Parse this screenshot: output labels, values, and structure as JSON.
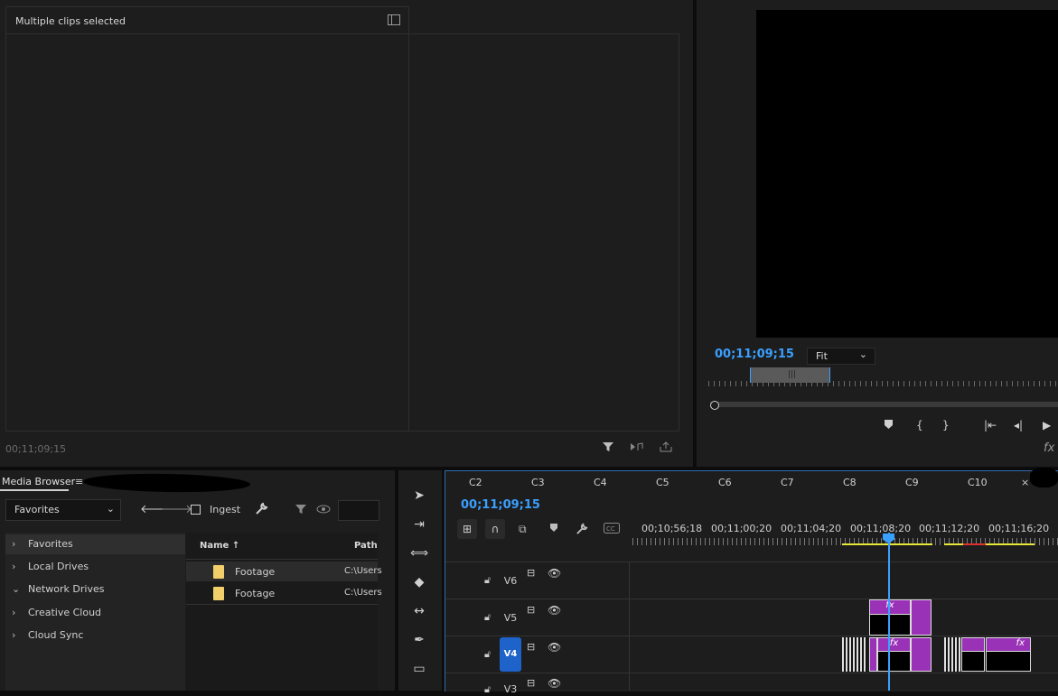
{
  "effect_controls": {
    "title": "Multiple clips selected",
    "timecode": "00;11;09;15"
  },
  "program_monitor": {
    "timecode": "00;11;09;15",
    "fit_selected": "Fit",
    "fx_label": "fx"
  },
  "media_browser": {
    "title": "Media Browser",
    "menu_glyph": "≡",
    "location_selected": "Favorites",
    "ingest_label": "Ingest",
    "tree": [
      {
        "label": "Favorites",
        "expanded": false
      },
      {
        "label": "Local Drives",
        "expanded": false
      },
      {
        "label": "Network Drives",
        "expanded": true
      },
      {
        "label": "Creative Cloud",
        "expanded": false
      },
      {
        "label": "Cloud Sync",
        "expanded": false
      }
    ],
    "columns": {
      "name": "Name",
      "path": "Path"
    },
    "rows": [
      {
        "name": "Footage",
        "path": "C:\\Users"
      },
      {
        "name": "Footage",
        "path": "C:\\Users"
      }
    ]
  },
  "timeline": {
    "tabs": [
      "C2",
      "C3",
      "C4",
      "C5",
      "C6",
      "C7",
      "C8",
      "C9",
      "C10"
    ],
    "close_glyph": "×",
    "timecode": "00;11;09;15",
    "ruler_labels": [
      "00;10;56;18",
      "00;11;00;20",
      "00;11;04;20",
      "00;11;08;20",
      "00;11;12;20",
      "00;11;16;20"
    ],
    "tracks": [
      {
        "name": "V6"
      },
      {
        "name": "V5"
      },
      {
        "name": "V4"
      },
      {
        "name": "V3"
      }
    ],
    "fx_label": "fx"
  },
  "colors": {
    "accent": "#3aa0ff",
    "clip": "#9a32b8",
    "target": "#1e63c9",
    "folder": "#f2cf6b"
  }
}
